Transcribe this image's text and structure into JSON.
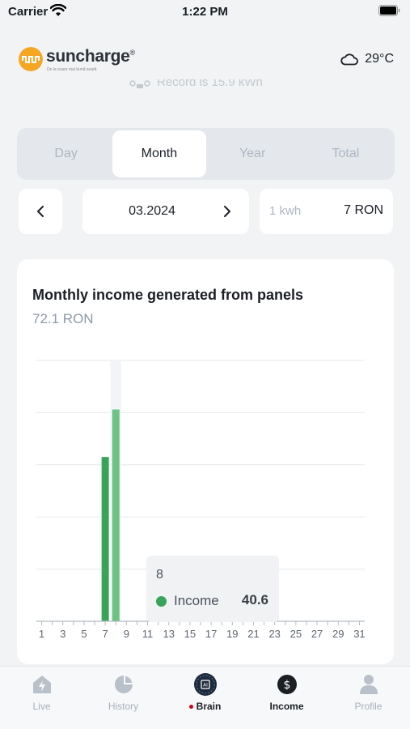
{
  "status_bar": {
    "carrier": "Carrier",
    "time": "1:22 PM"
  },
  "header": {
    "logo_text": "suncharge",
    "logo_tagline": "De la soare mai bună seară",
    "weather_icon": "cloud-icon",
    "temperature": "29°C"
  },
  "record_banner": {
    "text": "Record is 15.9 kWh",
    "icon": "drone-icon"
  },
  "period_tabs": [
    {
      "label": "Day",
      "active": false
    },
    {
      "label": "Month",
      "active": true
    },
    {
      "label": "Year",
      "active": false
    },
    {
      "label": "Total",
      "active": false
    }
  ],
  "date_nav": {
    "prev_icon": "chevron-left-icon",
    "current_period": "03.2024",
    "next_icon": "chevron-right-icon"
  },
  "rate": {
    "unit": "1 kwh",
    "value": "7 RON"
  },
  "chart_card": {
    "title": "Monthly income generated from panels",
    "total": "72.1 RON"
  },
  "chart_data": {
    "type": "bar",
    "x": [
      1,
      2,
      3,
      4,
      5,
      6,
      7,
      8,
      9,
      10,
      11,
      12,
      13,
      14,
      15,
      16,
      17,
      18,
      19,
      20,
      21,
      22,
      23,
      24,
      25,
      26,
      27,
      28,
      29,
      30,
      31
    ],
    "x_tick_labels": [
      "1",
      "3",
      "5",
      "7",
      "9",
      "11",
      "13",
      "15",
      "17",
      "19",
      "21",
      "23",
      "25",
      "27",
      "29",
      "31"
    ],
    "series": [
      {
        "name": "Income",
        "values": [
          0,
          0,
          0,
          0,
          0,
          0,
          31.5,
          40.6,
          0,
          0,
          0,
          0,
          0,
          0,
          0,
          0,
          0,
          0,
          0,
          0,
          0,
          0,
          0,
          0,
          0,
          0,
          0,
          0,
          0,
          0,
          0
        ]
      }
    ],
    "ylim": [
      0,
      50
    ],
    "grid": true,
    "highlighted_index": 7,
    "bar_color": "#3aa35a",
    "highlight_color": "#6cc383"
  },
  "tooltip": {
    "day": "8",
    "label": "Income",
    "value": "40.6"
  },
  "tab_bar": [
    {
      "label": "Live",
      "icon": "house-bolt-icon",
      "active": false
    },
    {
      "label": "History",
      "icon": "pie-chart-icon",
      "active": false
    },
    {
      "label": "Brain",
      "icon": "ai-chip-icon",
      "active": false
    },
    {
      "label": "Income",
      "icon": "dollar-circle-icon",
      "active": true
    },
    {
      "label": "Profile",
      "icon": "person-icon",
      "active": false
    }
  ],
  "colors": {
    "accent": "#f5a623",
    "income_green": "#3aa35a",
    "notification_dot": "#d0021b"
  }
}
